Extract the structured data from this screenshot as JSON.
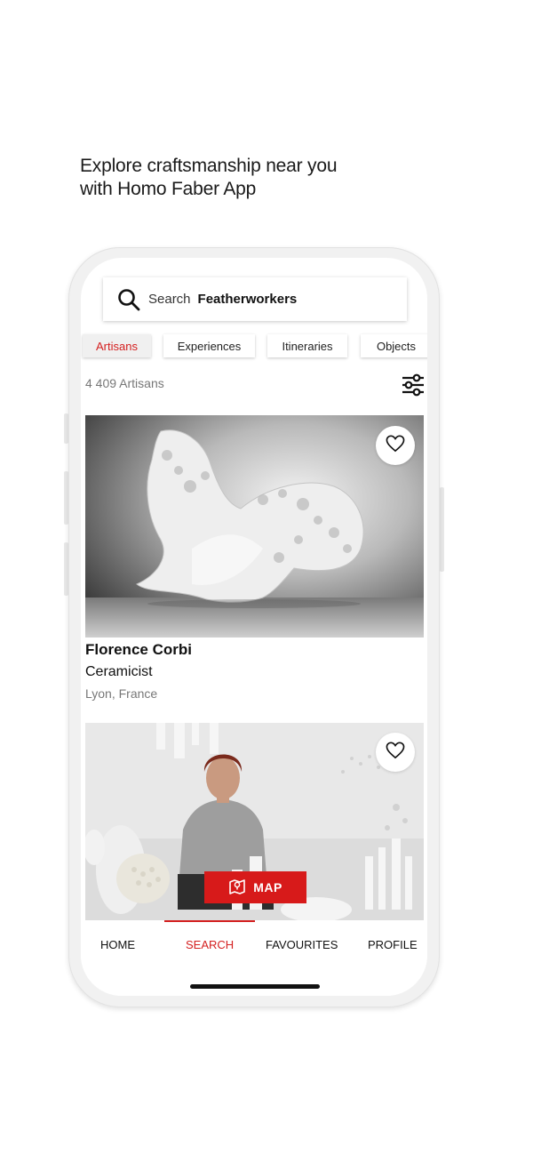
{
  "headline": {
    "line1": "Explore craftsmanship near you",
    "line2": "with Homo Faber App"
  },
  "search": {
    "prefix": "Search",
    "query": "Featherworkers"
  },
  "tabs": [
    {
      "label": "Artisans",
      "active": true
    },
    {
      "label": "Experiences",
      "active": false
    },
    {
      "label": "Itineraries",
      "active": false
    },
    {
      "label": "Objects",
      "active": false
    }
  ],
  "results": {
    "count_text": "4 409 Artisans"
  },
  "cards": [
    {
      "name": "Florence Corbi",
      "craft": "Ceramicist",
      "location": "Lyon, France",
      "favourited": false
    },
    {
      "favourited": false
    }
  ],
  "map_button": {
    "label": "MAP"
  },
  "nav": {
    "items": [
      {
        "label": "HOME",
        "active": false
      },
      {
        "label": "SEARCH",
        "active": true
      },
      {
        "label": "FAVOURITES",
        "active": false
      },
      {
        "label": "PROFILE",
        "active": false
      }
    ]
  },
  "colors": {
    "accent": "#d42020",
    "map_button": "#d71a1a",
    "muted_text": "#777777"
  }
}
